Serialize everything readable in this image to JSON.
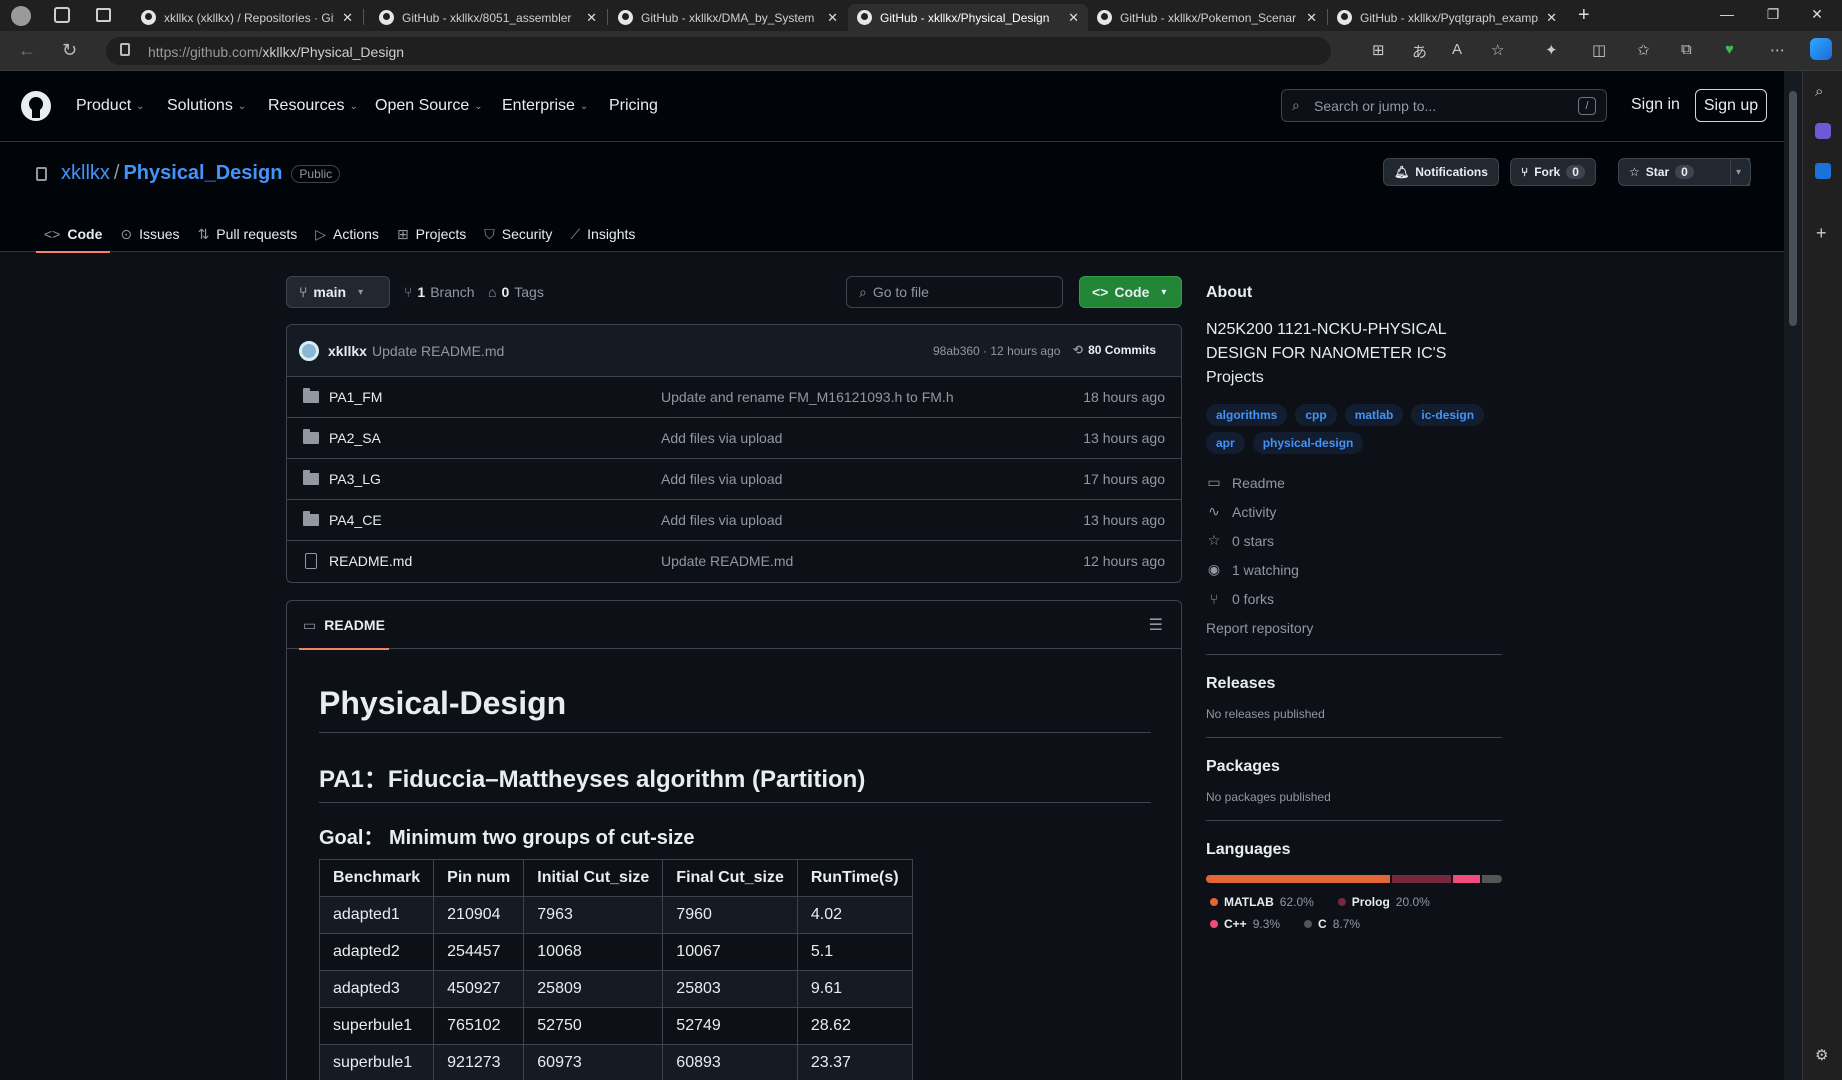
{
  "browser": {
    "tabs": [
      {
        "label": "xkllkx (xkllkx) / Repositories · Git"
      },
      {
        "label": "GitHub - xkllkx/8051_assembler"
      },
      {
        "label": "GitHub - xkllkx/DMA_by_System"
      },
      {
        "label": "GitHub - xkllkx/Physical_Design"
      },
      {
        "label": "GitHub - xkllkx/Pokemon_Scenar"
      },
      {
        "label": "GitHub - xkllkx/Pyqtgraph_examp"
      }
    ],
    "url_host": "https://github.com/",
    "url_path": "xkllkx/Physical_Design"
  },
  "header": {
    "nav": [
      "Product",
      "Solutions",
      "Resources",
      "Open Source",
      "Enterprise",
      "Pricing"
    ],
    "search_placeholder": "Search or jump to...",
    "search_shortcut": "/",
    "sign_in": "Sign in",
    "sign_up": "Sign up"
  },
  "repo": {
    "owner": "xkllkx",
    "name": "Physical_Design",
    "visibility": "Public",
    "notifications": "Notifications",
    "fork_label": "Fork",
    "fork_count": "0",
    "star_label": "Star",
    "star_count": "0",
    "tabs": [
      "Code",
      "Issues",
      "Pull requests",
      "Actions",
      "Projects",
      "Security",
      "Insights"
    ]
  },
  "code": {
    "branch": "main",
    "branches": "1",
    "branches_label": "Branch",
    "tags": "0",
    "tags_label": "Tags",
    "goto_placeholder": "Go to file",
    "code_button": "Code",
    "commit": {
      "author": "xkllkx",
      "message": "Update README.md",
      "sha_time": "98ab360 · 12 hours ago",
      "commits": "80 Commits"
    },
    "files": [
      {
        "name": "PA1_FM",
        "type": "dir",
        "message": "Update and rename FM_M16121093.h to FM.h",
        "time": "18 hours ago"
      },
      {
        "name": "PA2_SA",
        "type": "dir",
        "message": "Add files via upload",
        "time": "13 hours ago"
      },
      {
        "name": "PA3_LG",
        "type": "dir",
        "message": "Add files via upload",
        "time": "17 hours ago"
      },
      {
        "name": "PA4_CE",
        "type": "dir",
        "message": "Add files via upload",
        "time": "13 hours ago"
      },
      {
        "name": "README.md",
        "type": "file",
        "message": "Update README.md",
        "time": "12 hours ago"
      }
    ]
  },
  "readme": {
    "tab": "README",
    "h1": "Physical-Design",
    "h2": "PA1：Fiduccia–Mattheyses algorithm (Partition)",
    "h3": "Goal： Minimum two groups of cut-size",
    "table": {
      "headers": [
        "Benchmark",
        "Pin num",
        "Initial Cut_size",
        "Final Cut_size",
        "RunTime(s)"
      ],
      "rows": [
        [
          "adapted1",
          "210904",
          "7963",
          "7960",
          "4.02"
        ],
        [
          "adapted2",
          "254457",
          "10068",
          "10067",
          "5.1"
        ],
        [
          "adapted3",
          "450927",
          "25809",
          "25803",
          "9.61"
        ],
        [
          "superbule1",
          "765102",
          "52750",
          "52749",
          "28.62"
        ],
        [
          "superbule1",
          "921273",
          "60973",
          "60893",
          "23.37"
        ]
      ]
    }
  },
  "about": {
    "title": "About",
    "description": "N25K200 1121-NCKU-PHYSICAL DESIGN FOR NANOMETER IC'S Projects",
    "topics": [
      "algorithms",
      "cpp",
      "matlab",
      "ic-design",
      "apr",
      "physical-design"
    ],
    "links": [
      {
        "icon": "book-icon",
        "label": "Readme"
      },
      {
        "icon": "pulse-icon",
        "label": "Activity"
      },
      {
        "icon": "star-icon",
        "label": "0 stars"
      },
      {
        "icon": "eye-icon",
        "label": "1 watching"
      },
      {
        "icon": "fork-icon",
        "label": "0 forks"
      }
    ],
    "report": "Report repository",
    "releases_title": "Releases",
    "releases_text": "No releases published",
    "packages_title": "Packages",
    "packages_text": "No packages published",
    "languages_title": "Languages",
    "languages": [
      {
        "name": "MATLAB",
        "pct": "62.0%",
        "value": 62.0,
        "color": "#e16737"
      },
      {
        "name": "Prolog",
        "pct": "20.0%",
        "value": 20.0,
        "color": "#74283c"
      },
      {
        "name": "C++",
        "pct": "9.3%",
        "value": 9.3,
        "color": "#f34b7d"
      },
      {
        "name": "C",
        "pct": "8.7%",
        "value": 8.7,
        "color": "#555555"
      }
    ]
  }
}
